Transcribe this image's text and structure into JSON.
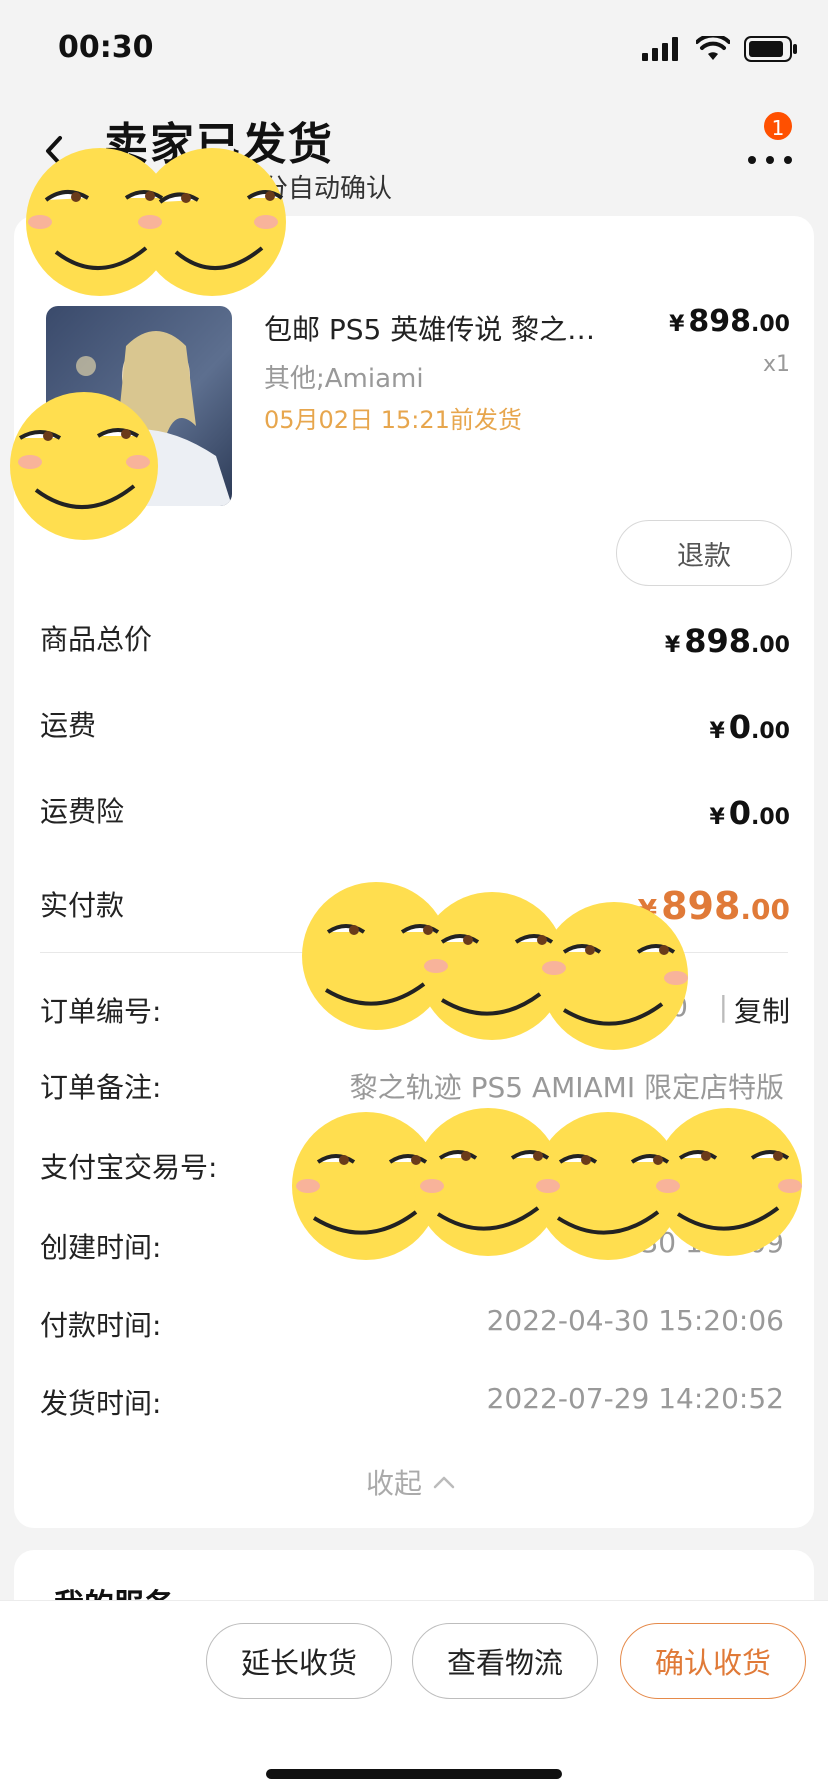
{
  "status_bar": {
    "time": "00:30"
  },
  "header": {
    "title": "卖家已发货",
    "subtitle": "分自动确认",
    "more_badge": "1"
  },
  "product": {
    "title": "包邮 PS5 英雄传说 黎之…",
    "spec": "其他;Amiami",
    "ship_deadline": "05月02日 15:21前发货",
    "price_main": "898",
    "price_dec": ".00",
    "qty": "x1",
    "refund_label": "退款"
  },
  "summary": {
    "goods_total_label": "商品总价",
    "goods_total_main": "898",
    "goods_total_dec": ".00",
    "shipping_label": "运费",
    "shipping_main": "0",
    "shipping_dec": ".00",
    "shipping_insurance_label": "运费险",
    "shipping_insurance_main": "0",
    "shipping_insurance_dec": ".00",
    "paid_label": "实付款",
    "paid_main": "898",
    "paid_dec": ".00",
    "currency": "¥"
  },
  "order_info": {
    "order_no_label": "订单编号:",
    "order_no_tail": "0",
    "copy_label": "复制",
    "separator": "|",
    "remark_label": "订单备注:",
    "remark_value": "黎之轨迹 PS5 AMIAMI 限定店特版",
    "alipay_label": "支付宝交易号:",
    "created_label": "创建时间:",
    "created_tail": "22-   -30 15:  :09",
    "paid_time_label": "付款时间:",
    "paid_time_value": "2022-04-30 15:20:06",
    "shipped_time_label": "发货时间:",
    "shipped_time_value": "2022-07-29 14:20:52",
    "collapse_label": "收起"
  },
  "services": {
    "title": "我的服务"
  },
  "bottom_bar": {
    "extend_label": "延长收货",
    "logistics_label": "查看物流",
    "confirm_label": "确认收货"
  },
  "colors": {
    "accent": "#e07a38",
    "ship_deadline": "#e7a64d",
    "badge": "#ff5000",
    "emoji_face": "#ffde4f"
  }
}
